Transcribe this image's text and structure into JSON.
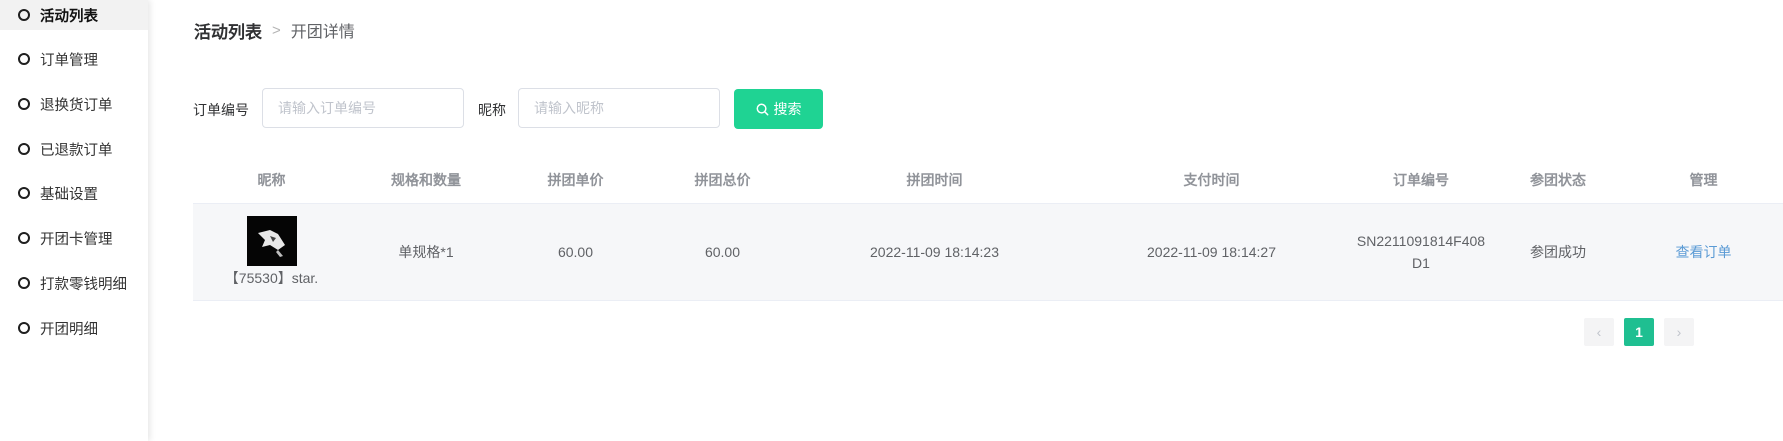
{
  "sidebar": {
    "items": [
      {
        "label": "活动列表",
        "active": true
      },
      {
        "label": "订单管理"
      },
      {
        "label": "退换货订单"
      },
      {
        "label": "已退款订单"
      },
      {
        "label": "基础设置"
      },
      {
        "label": "开团卡管理"
      },
      {
        "label": "打款零钱明细"
      },
      {
        "label": "开团明细"
      }
    ]
  },
  "breadcrumb": {
    "root": "活动列表",
    "separator": ">",
    "current": "开团详情"
  },
  "filters": {
    "order_no_label": "订单编号",
    "order_no_placeholder": "请输入订单编号",
    "nickname_label": "昵称",
    "nickname_placeholder": "请输入昵称",
    "search_label": "搜索"
  },
  "table": {
    "columns": [
      "昵称",
      "规格和数量",
      "拼团单价",
      "拼团总价",
      "拼团时间",
      "支付时间",
      "订单编号",
      "参团状态",
      "管理"
    ],
    "rows": [
      {
        "nickname": "【75530】star.",
        "spec": "单规格*1",
        "unit_price": "60.00",
        "total_price": "60.00",
        "group_time": "2022-11-09 18:14:23",
        "pay_time": "2022-11-09 18:14:27",
        "order_no": "SN2211091814F408D1",
        "status": "参团成功",
        "action": "查看订单"
      }
    ]
  },
  "pagination": {
    "prev": "‹",
    "current_page": "1",
    "next": "›"
  },
  "colors": {
    "accent": "#1fd393",
    "page_active": "#1fbf91",
    "link": "#5b9bd5"
  }
}
